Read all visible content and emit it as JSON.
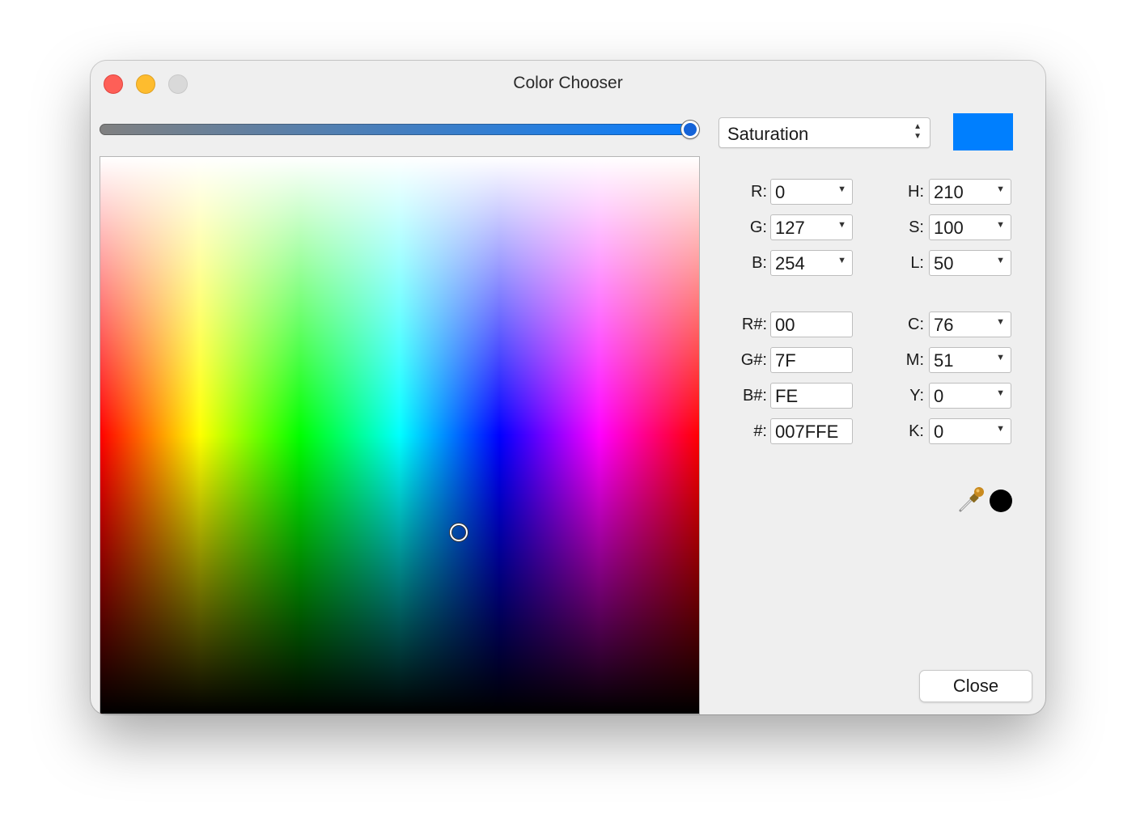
{
  "window": {
    "title": "Color Chooser"
  },
  "mode": {
    "selected": "Saturation",
    "slider_value_percent": 100
  },
  "current_color": "#007FFE",
  "rgb": [
    {
      "label": "R:",
      "value": "0"
    },
    {
      "label": "G:",
      "value": "127"
    },
    {
      "label": "B:",
      "value": "254"
    }
  ],
  "hsl": [
    {
      "label": "H:",
      "value": "210"
    },
    {
      "label": "S:",
      "value": "100"
    },
    {
      "label": "L:",
      "value": "50"
    }
  ],
  "hex": [
    {
      "label": "R#:",
      "value": "00"
    },
    {
      "label": "G#:",
      "value": "7F"
    },
    {
      "label": "B#:",
      "value": "FE"
    },
    {
      "label": "#:",
      "value": "007FFE"
    }
  ],
  "cmyk": [
    {
      "label": "C:",
      "value": "76"
    },
    {
      "label": "M:",
      "value": "51"
    },
    {
      "label": "Y:",
      "value": "0"
    },
    {
      "label": "K:",
      "value": "0"
    }
  ],
  "icons": {
    "eyedropper": "eyedropper-icon",
    "sample": "sampled-color-dot"
  },
  "close_label": "Close"
}
